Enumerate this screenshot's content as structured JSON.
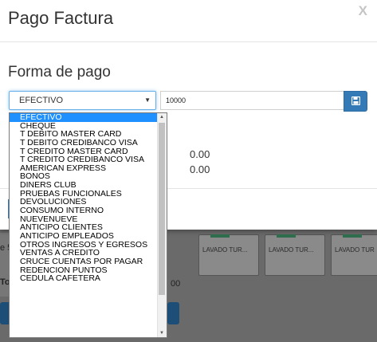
{
  "modal": {
    "title": "Pago Factura",
    "close": "X",
    "section_title": "Forma de pago",
    "payment_method": {
      "selected": "EFECTIVO",
      "options": [
        "EFECTIVO",
        "CHEQUE",
        "T DEBITO MASTER CARD",
        "T DEBITO CREDIBANCO VISA",
        "T CREDITO MASTER CARD",
        "T CREDITO CREDIBANCO VISA",
        "AMERICAN EXPRESS",
        "BONOS",
        "DINERS CLUB",
        "PRUEBAS FUNCIONALES",
        "DEVOLUCIONES",
        "CONSUMO INTERNO",
        "NUEVENUEVE",
        "ANTICIPO CLIENTES",
        "ANTICIPO EMPLEADOS",
        "OTROS INGRESOS Y EGRESOS",
        "VENTAS A CREDITO",
        "CRUCE CUENTAS POR PAGAR",
        "REDENCION PUNTOS",
        "CEDULA CAFETERA"
      ]
    },
    "amount": "10000",
    "values": [
      "0.00",
      "0.00"
    ]
  },
  "background": {
    "tiles": [
      "LAVADO TUR...",
      "LAVADO TUR...",
      "LAVADO TUR"
    ],
    "left_text_1": "e 5",
    "left_text_2": "To",
    "right_text": "00"
  },
  "colors": {
    "primary": "#337ab7",
    "selected_option": "#1e90ff",
    "overlay": "#5f5f5f"
  }
}
